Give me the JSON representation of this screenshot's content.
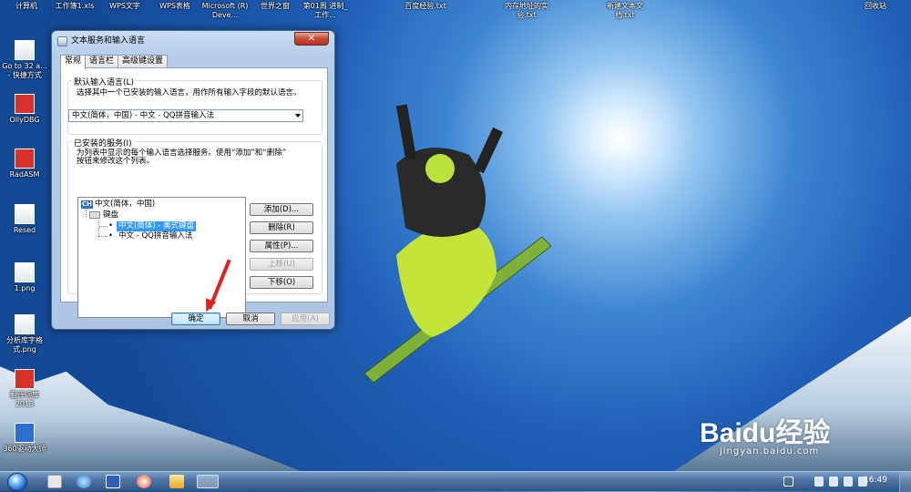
{
  "desktop": {
    "top_icons": [
      {
        "label": "计算机"
      },
      {
        "label": "工作簿1.xls"
      },
      {
        "label": "WPS文字"
      },
      {
        "label": "WPS表格"
      },
      {
        "label": "Microsoft (R) Deve..."
      },
      {
        "label": "世界之窗"
      },
      {
        "label": "第01周 进制_工作..."
      },
      {
        "label": "百度经验.txt"
      },
      {
        "label": "内存地址的实验.txt"
      },
      {
        "label": "新建文本文档.txt"
      },
      {
        "label": "回收站"
      }
    ],
    "left_icons": [
      {
        "label": "Go to 32 a... - 快捷方式"
      },
      {
        "label": "OllyDBG"
      },
      {
        "label": "RadASM"
      },
      {
        "label": "Resed"
      },
      {
        "label": "1.png"
      },
      {
        "label": "分析库字格式.png"
      },
      {
        "label": "翻译词库 2013"
      },
      {
        "label": "360驱动大师"
      }
    ]
  },
  "dialog": {
    "title": "文本服务和输入语言",
    "close": "✕",
    "tabs": [
      "常规",
      "语言栏",
      "高级键设置"
    ],
    "default_group": {
      "title": "默认输入语言(L)",
      "desc": "选择其中一个已安装的输入语言，用作所有输入字段的默认语言。",
      "selected": "中文(简体，中国) - 中文 - QQ拼音输入法"
    },
    "installed_group": {
      "title": "已安装的服务(I)",
      "desc_line1": "为列表中显示的每个输入语言选择服务。使用“添加”和“删除”",
      "desc_line2": "按钮来修改这个列表。",
      "tree": {
        "badge": "CH",
        "language": "中文(简体，中国)",
        "category": "键盘",
        "items": [
          "中文(简体) - 美式键盘",
          "中文 - QQ拼音输入法"
        ]
      },
      "buttons": {
        "add": "添加(D)...",
        "remove": "删除(R)",
        "properties": "属性(P)...",
        "move_up": "上移(U)",
        "move_down": "下移(O)"
      }
    },
    "footer": {
      "ok": "确定",
      "cancel": "取消",
      "apply": "应用(A)"
    }
  },
  "taskbar": {
    "time": "16:49"
  },
  "watermark": {
    "text": "Baidu经验",
    "url": "jingyan.baidu.com"
  },
  "colors": {
    "selection": "#3399ff",
    "annotation_arrow": "#e02020",
    "taskbar": "#4f76a6"
  }
}
